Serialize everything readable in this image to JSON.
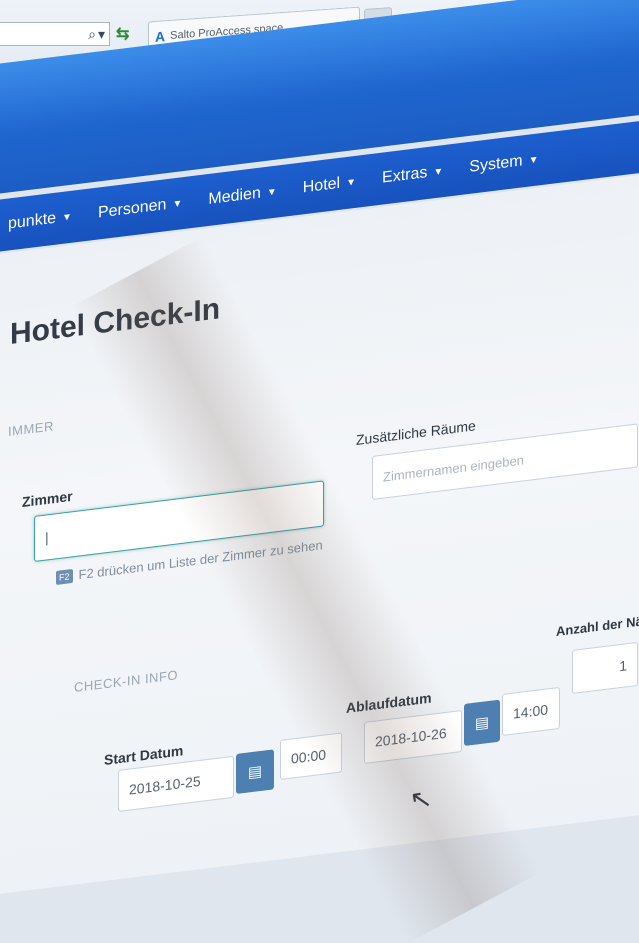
{
  "browser": {
    "tab_title": "Salto ProAccess space",
    "tab_logo": "A",
    "tab_close": "×"
  },
  "nav": {
    "items": [
      "punkte",
      "Personen",
      "Medien",
      "Hotel",
      "Extras",
      "System"
    ]
  },
  "page": {
    "title": "Hotel Check-In"
  },
  "room_section": {
    "label": "IMMER",
    "room_label": "Zimmer",
    "room_value": "|",
    "hint_key": "F2",
    "hint_text": "F2 drücken um Liste der Zimmer zu sehen",
    "extra_rooms_label": "Zusätzliche Räume",
    "extra_rooms_placeholder": "Zimmernamen eingeben"
  },
  "checkin_section": {
    "label": "CHECK-IN INFO",
    "start_label": "Start Datum",
    "start_date": "2018-10-25",
    "start_time": "00:00",
    "expiry_label": "Ablaufdatum",
    "expiry_date": "2018-10-26",
    "expiry_time": "14:00",
    "nights_label": "Anzahl der Näc",
    "nights_value": "1"
  },
  "colors": {
    "header_blue": "#1f66cf",
    "nav_blue": "#1752bd",
    "calendar_button": "#4d7fb0",
    "focus_border": "#3aa0a0"
  },
  "icons": {
    "search": "search-icon",
    "dropdown": "chevron-down-icon",
    "refresh": "refresh-icon",
    "calendar": "calendar-icon",
    "cursor": "mouse-cursor-icon"
  }
}
